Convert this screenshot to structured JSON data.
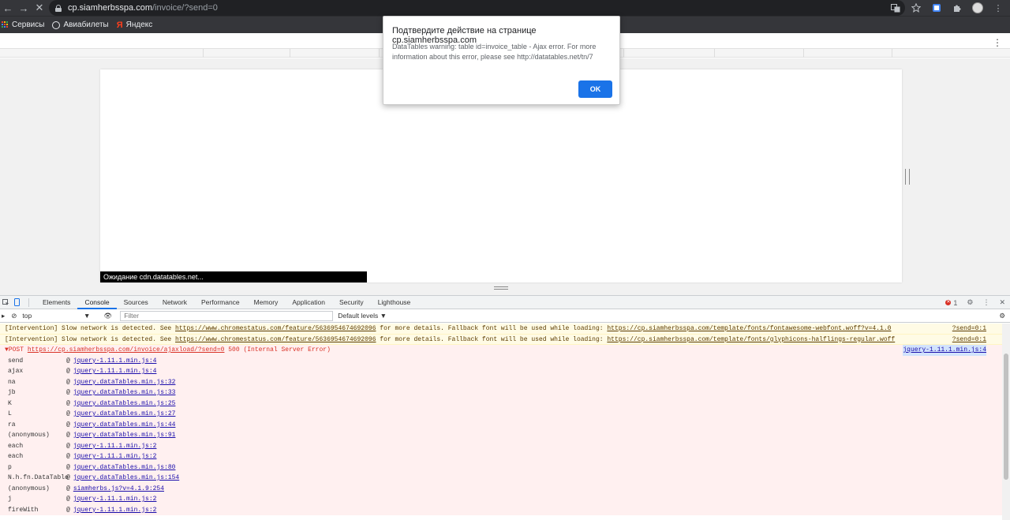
{
  "browser": {
    "url_host": "cp.siamherbsspa.com",
    "url_path": "/invoice/?send=0",
    "back_icon": "←",
    "forward_icon": "→",
    "stop_icon": "✕"
  },
  "bookmarks": [
    {
      "label": "Сервисы"
    },
    {
      "label": "Авиабилеты"
    },
    {
      "label": "Яндекс",
      "glyph": "Я"
    }
  ],
  "page": {
    "status_text": "Ожидание cdn.datatables.net...",
    "kebab": "⋮"
  },
  "dialog": {
    "title": "Подтвердите действие на странице cp.siamherbsspa.com",
    "message": "DataTables warning: table id=invoice_table - Ajax error. For more information about this error, please see http://datatables.net/tn/7",
    "ok_label": "OK"
  },
  "devtools": {
    "tabs": [
      "Elements",
      "Console",
      "Sources",
      "Network",
      "Performance",
      "Memory",
      "Application",
      "Security",
      "Lighthouse"
    ],
    "active_tab": "Console",
    "error_count": "1",
    "context": "top",
    "filter_placeholder": "Filter",
    "levels_label": "Default levels ▼",
    "warnings": [
      {
        "prefix": "[Intervention] Slow network is detected. See ",
        "link1": "https://www.chromestatus.com/feature/5636954674692096",
        "middle": " for more details. Fallback font will be used while loading: ",
        "link2": "https://cp.siamherbsspa.com/template/fonts/fontawesome-webfont.woff?v=4.1.0",
        "source": "?send=0:1"
      },
      {
        "prefix": "[Intervention] Slow network is detected. See ",
        "link1": "https://www.chromestatus.com/feature/5636954674692096",
        "middle": " for more details. Fallback font will be used while loading: ",
        "link2": "https://cp.siamherbsspa.com/template/fonts/glyphicons-halflings-regular.woff",
        "source": "?send=0:1"
      }
    ],
    "error": {
      "method": "▼POST ",
      "url": "https://cp.siamherbsspa.com/invoice/ajaxload/?send=0",
      "status": " 500 (Internal Server Error)",
      "source": "jquery-1.11.1.min.js:4"
    },
    "stack": [
      {
        "fn": "send",
        "loc": "jquery-1.11.1.min.js:4"
      },
      {
        "fn": "ajax",
        "loc": "jquery-1.11.1.min.js:4"
      },
      {
        "fn": "na",
        "loc": "jquery.dataTables.min.js:32"
      },
      {
        "fn": "jb",
        "loc": "jquery.dataTables.min.js:33"
      },
      {
        "fn": "K",
        "loc": "jquery.dataTables.min.js:25"
      },
      {
        "fn": "L",
        "loc": "jquery.dataTables.min.js:27"
      },
      {
        "fn": "ra",
        "loc": "jquery.dataTables.min.js:44"
      },
      {
        "fn": "(anonymous)",
        "loc": "jquery.dataTables.min.js:91"
      },
      {
        "fn": "each",
        "loc": "jquery-1.11.1.min.js:2"
      },
      {
        "fn": "each",
        "loc": "jquery-1.11.1.min.js:2"
      },
      {
        "fn": "p",
        "loc": "jquery.dataTables.min.js:80"
      },
      {
        "fn": "N.h.fn.DataTable",
        "loc": "jquery.dataTables.min.js:154"
      },
      {
        "fn": "(anonymous)",
        "loc": "siamherbs.js?v=4.1.9:254"
      },
      {
        "fn": "j",
        "loc": "jquery-1.11.1.min.js:2"
      },
      {
        "fn": "fireWith",
        "loc": "jquery-1.11.1.min.js:2"
      }
    ]
  },
  "colors": {
    "chrome_dark": "#35363a",
    "accent_blue": "#1a73e8",
    "error_red": "#d93025",
    "warning_bg": "#fffbe5",
    "error_bg": "#fff0f0"
  }
}
